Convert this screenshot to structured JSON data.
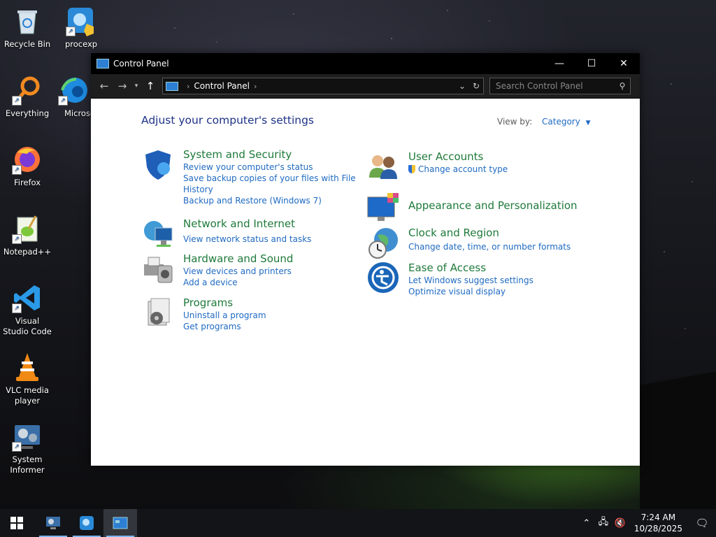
{
  "desktop": {
    "icons": [
      {
        "label": "Recycle Bin"
      },
      {
        "label": "procexp"
      },
      {
        "label": "Everything"
      },
      {
        "label": "Microsoft Edge"
      },
      {
        "label": "Firefox"
      },
      {
        "label": "Notepad++"
      },
      {
        "label": "Visual Studio Code"
      },
      {
        "label": "VLC media player"
      },
      {
        "label": "System Informer"
      }
    ]
  },
  "window": {
    "title": "Control Panel",
    "controls": {
      "minimize": "—",
      "maximize": "☐",
      "close": "✕"
    },
    "address": {
      "breadcrumb": "Control Panel",
      "search_placeholder": "Search Control Panel"
    },
    "heading": "Adjust your computer's settings",
    "view_by": {
      "label": "View by:",
      "value": "Category"
    },
    "categories_left": [
      {
        "icon": "shield-icon",
        "title": "System and Security",
        "links": [
          "Review your computer's status",
          "Save backup copies of your files with File",
          "History",
          "Backup and Restore (Windows 7)"
        ]
      },
      {
        "icon": "network-globe-icon",
        "title": "Network and Internet",
        "links": [
          "View network status and tasks"
        ]
      },
      {
        "icon": "printer-icon",
        "title": "Hardware and Sound",
        "links": [
          "View devices and printers",
          "Add a device"
        ]
      },
      {
        "icon": "programs-icon",
        "title": "Programs",
        "links": [
          "Uninstall a program",
          "Get programs"
        ]
      }
    ],
    "categories_right": [
      {
        "icon": "users-icon",
        "title": "User Accounts",
        "links": [
          "Change account type"
        ]
      },
      {
        "icon": "monitor-palette-icon",
        "title": "Appearance and Personalization",
        "links": []
      },
      {
        "icon": "globe-clock-icon",
        "title": "Clock and Region",
        "links": [
          "Change date, time, or number formats"
        ]
      },
      {
        "icon": "accessibility-icon",
        "title": "Ease of Access",
        "links": [
          "Let Windows suggest settings",
          "Optimize visual display"
        ]
      }
    ]
  },
  "taskbar": {
    "time": "7:24 AM",
    "date": "10/28/2025"
  },
  "colors": {
    "title_green": "#1e7a3a",
    "link_blue": "#1f6ac2",
    "heading_blue": "#1e3287"
  }
}
